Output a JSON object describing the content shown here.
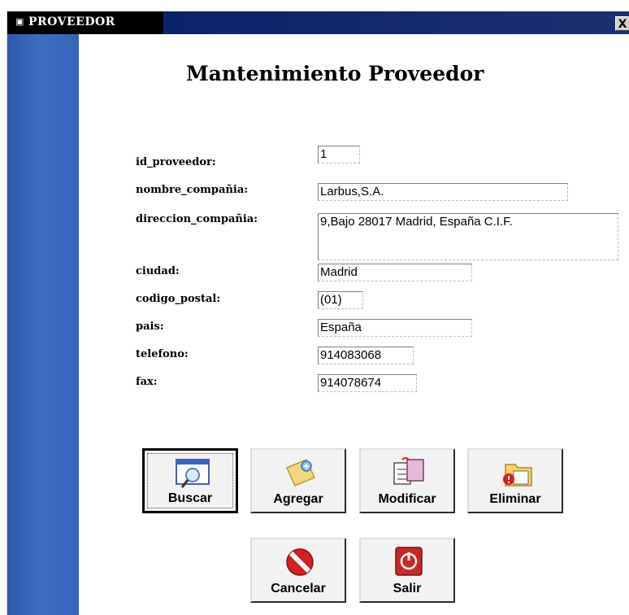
{
  "window": {
    "title": "PROVEEDOR",
    "title_icon": "window-icon",
    "close_label": "X"
  },
  "form": {
    "title": "Mantenimiento Proveedor"
  },
  "fields": [
    {
      "label": "id_proveedor:",
      "value": "1"
    },
    {
      "label": "nombre_compañia:",
      "value": "Larbus,S.A."
    },
    {
      "label": "direccion_compañia:",
      "value": "9,Bajo 28017 Madrid, España C.I.F."
    },
    {
      "label": "ciudad:",
      "value": "Madrid"
    },
    {
      "label": "codigo_postal:",
      "value": "(01)"
    },
    {
      "label": "pais:",
      "value": "España"
    },
    {
      "label": "telefono:",
      "value": "914083068"
    },
    {
      "label": "fax:",
      "value": "914078674"
    }
  ],
  "buttons": {
    "buscar": {
      "label": "Buscar",
      "icon": "search-window-icon"
    },
    "agregar": {
      "label": "Agregar",
      "icon": "add-document-icon"
    },
    "modificar": {
      "label": "Modificar",
      "icon": "edit-documents-icon"
    },
    "eliminar": {
      "label": "Eliminar",
      "icon": "delete-folder-icon"
    },
    "cancelar": {
      "label": "Cancelar",
      "icon": "cancel-icon"
    },
    "salir": {
      "label": "Salir",
      "icon": "power-exit-icon"
    }
  },
  "colors": {
    "titlebar": "#0a246a",
    "sidebar": "#3366b8",
    "cancel_red": "#d42020",
    "exit_red": "#c62828"
  }
}
